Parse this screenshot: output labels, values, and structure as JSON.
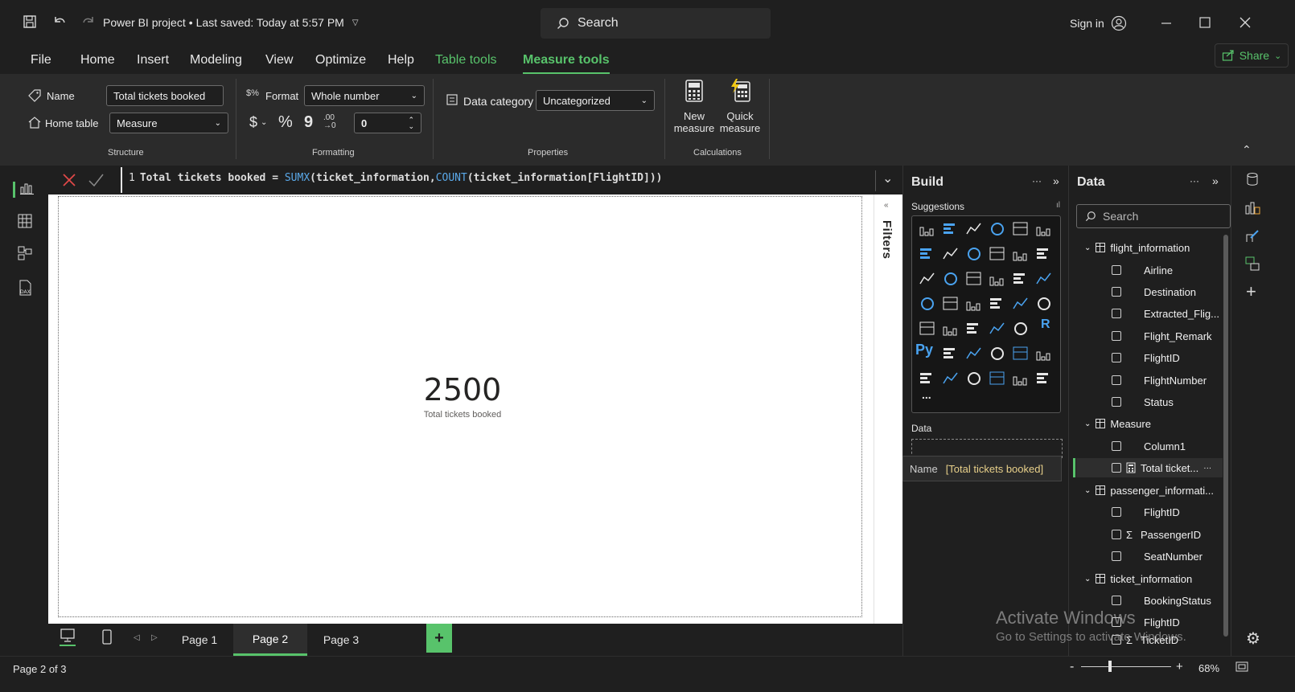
{
  "titlebar": {
    "doc_title": "Power BI project",
    "saved_status": "Last saved: Today at 5:57 PM",
    "search_label": "Search",
    "signin_label": "Sign in"
  },
  "menu": {
    "items": [
      "File",
      "Home",
      "Insert",
      "Modeling",
      "View",
      "Optimize",
      "Help",
      "Table tools",
      "Measure tools"
    ],
    "share_label": "Share"
  },
  "ribbon": {
    "name_label": "Name",
    "name_value": "Total tickets booked",
    "home_table_label": "Home table",
    "home_table_value": "Measure",
    "structure_label": "Structure",
    "format_label": "Format",
    "format_value": "Whole number",
    "currency_symbol": "$",
    "percent_symbol": "%",
    "comma_symbol": "9",
    "decimals_value": "0",
    "formatting_label": "Formatting",
    "data_category_label": "Data category",
    "data_category_value": "Uncategorized",
    "properties_label": "Properties",
    "new_measure_line1": "New",
    "new_measure_line2": "measure",
    "quick_measure_line1": "Quick",
    "quick_measure_line2": "measure",
    "calculations_label": "Calculations"
  },
  "formula": {
    "line_no": "1",
    "prefix": "Total tickets booked = ",
    "fn1": "SUMX",
    "arg1": "(ticket_information,",
    "fn2": "COUNT",
    "arg2": "(ticket_information[FlightID]))"
  },
  "card": {
    "value": "2500",
    "label": "Total tickets booked"
  },
  "filters_label": "Filters",
  "pages": {
    "tabs": [
      "Page 1",
      "Page 2",
      "Page 3"
    ],
    "active": "Page 2"
  },
  "status": {
    "page_info": "Page 2 of 3",
    "zoom": "68%"
  },
  "build": {
    "title": "Build",
    "suggestions_label": "Suggestions",
    "data_label": "Data",
    "more_label": "...",
    "r_label": "R",
    "py_label": "Py"
  },
  "tooltip": {
    "key": "Name",
    "value": "[Total tickets booked]"
  },
  "data_pane": {
    "title": "Data",
    "search_placeholder": "Search",
    "tables": [
      {
        "name": "flight_information",
        "fields": [
          "Airline",
          "Destination",
          "Extracted_Flig...",
          "Flight_Remark",
          "FlightID",
          "FlightNumber",
          "Status"
        ]
      },
      {
        "name": "Measure",
        "fields": [
          "Column1",
          "Total ticket..."
        ]
      },
      {
        "name": "passenger_informati...",
        "fields": [
          "FlightID",
          "PassengerID",
          "SeatNumber"
        ]
      },
      {
        "name": "ticket_information",
        "fields": [
          "BookingStatus",
          "FlightID",
          "TicketID"
        ]
      }
    ]
  },
  "watermark": {
    "line1": "Activate Windows",
    "line2": "Go to Settings to activate Windows."
  },
  "colors": {
    "accent_green": "#58c36b",
    "canvas_bg": "#ffffff",
    "chrome_bg": "#1f1f1f",
    "ribbon_bg": "#2b2b2b"
  }
}
